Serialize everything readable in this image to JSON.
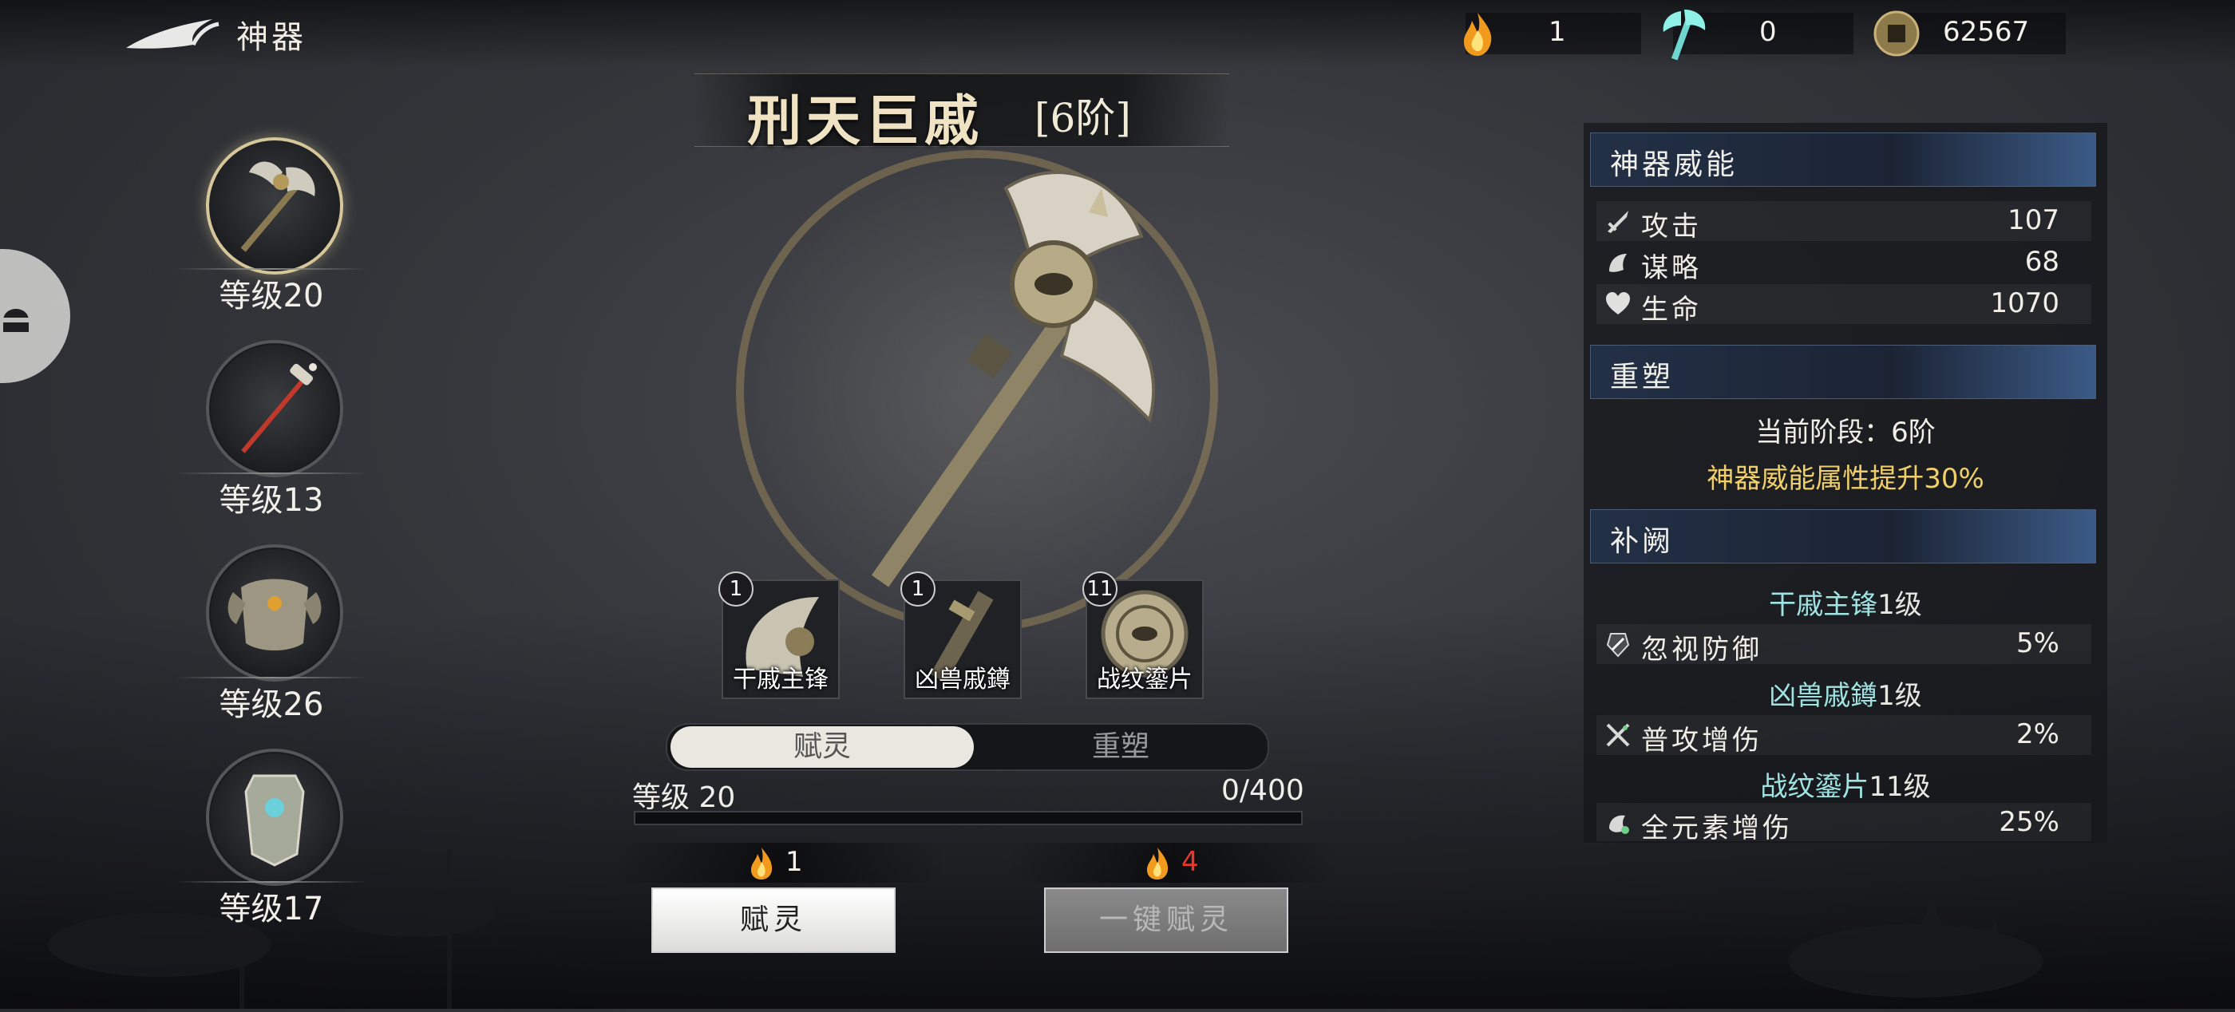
{
  "header": {
    "title": "神器"
  },
  "resources": [
    {
      "icon": "flame-icon",
      "value": "1"
    },
    {
      "icon": "axe-material-icon",
      "value": "0"
    },
    {
      "icon": "coin-icon",
      "value": "62567"
    }
  ],
  "equipment_list": [
    {
      "name": "axe",
      "icon": "axe-icon",
      "level_label": "等级20",
      "active": true
    },
    {
      "name": "staff",
      "icon": "staff-icon",
      "level_label": "等级13",
      "active": false
    },
    {
      "name": "armor",
      "icon": "armor-icon",
      "level_label": "等级26",
      "active": false
    },
    {
      "name": "shield",
      "icon": "shield-icon",
      "level_label": "等级17",
      "active": false
    }
  ],
  "weapon": {
    "name": "刑天巨戚",
    "tier": "[6阶]"
  },
  "parts": [
    {
      "count": "1",
      "label": "干戚主锋"
    },
    {
      "count": "1",
      "label": "凶兽戚鐏"
    },
    {
      "count": "11",
      "label": "战纹鎏片"
    }
  ],
  "tabs": {
    "active": "赋灵",
    "inactive": "重塑"
  },
  "progress": {
    "level_label": "等级  20",
    "value_text": "0/400",
    "fraction": 0.0
  },
  "costs": {
    "left": "1",
    "right": "4",
    "left_color": "#f4f2ea",
    "right_color": "#e8382e"
  },
  "buttons": {
    "primary": "赋灵",
    "secondary": "一键赋灵"
  },
  "panel": {
    "power": {
      "title": "神器威能",
      "stats": [
        {
          "icon": "sword-icon",
          "name": "攻击",
          "value": "107"
        },
        {
          "icon": "strategy-icon",
          "name": "谋略",
          "value": "68"
        },
        {
          "icon": "heart-icon",
          "name": "生命",
          "value": "1070"
        }
      ]
    },
    "remold": {
      "title": "重塑",
      "stage_text": "当前阶段：6阶",
      "bonus_text": "神器威能属性提升30%"
    },
    "supplement": {
      "title": "补阙",
      "groups": [
        {
          "part": "干戚主锋",
          "level": "1级",
          "icon": "pierce-icon",
          "stat": "忽视防御",
          "value": "5%"
        },
        {
          "part": "凶兽戚鐏",
          "level": "1级",
          "icon": "cross-swords-icon",
          "stat": "普攻增伤",
          "value": "2%"
        },
        {
          "part": "战纹鎏片",
          "level": "11级",
          "icon": "element-icon",
          "stat": "全元素增伤",
          "value": "25%"
        }
      ]
    }
  },
  "colors": {
    "accent_gold": "#f0cf6a",
    "teal": "#9fe3e3",
    "cost_red": "#e8382e"
  }
}
